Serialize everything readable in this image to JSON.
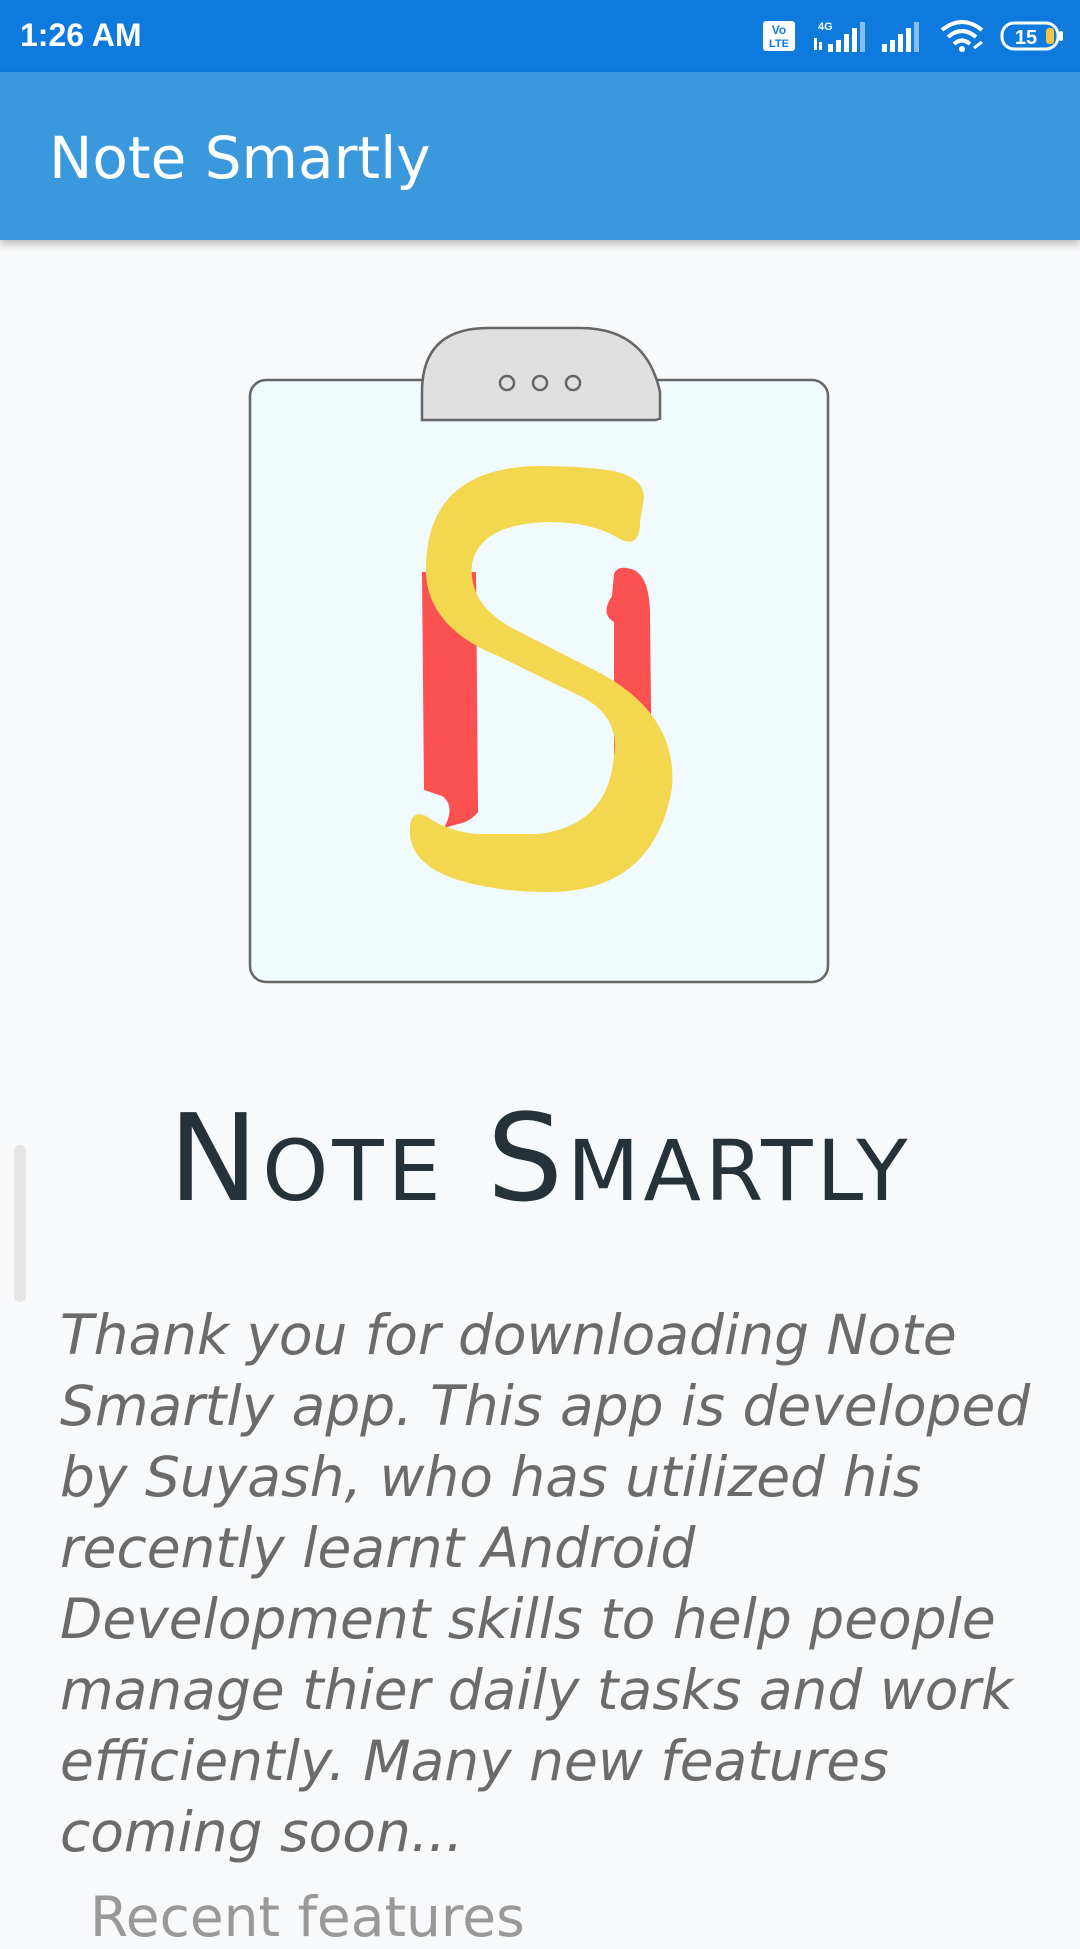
{
  "status_bar": {
    "time": "1:26 AM",
    "volte": "Vo\nLTE",
    "network": "4G",
    "battery": "15",
    "icons": [
      "volte-icon",
      "signal-4g-icon",
      "signal-icon",
      "wifi-icon",
      "battery-icon"
    ]
  },
  "app_bar": {
    "title": "Note Smartly"
  },
  "main": {
    "brand_name": "Note Smartly",
    "description": "Thank you for downloading Note Smartly app. This app is developed by Suyash, who has utilized his recently learnt Android Development skills to help people manage thier daily tasks and work efficiently. Many new features coming soon...",
    "next_heading": "Recent features"
  },
  "colors": {
    "status_bar": "#0e7ade",
    "app_bar": "#3a99dc",
    "logo_yellow": "#f2d74f",
    "logo_red": "#fb5151"
  }
}
